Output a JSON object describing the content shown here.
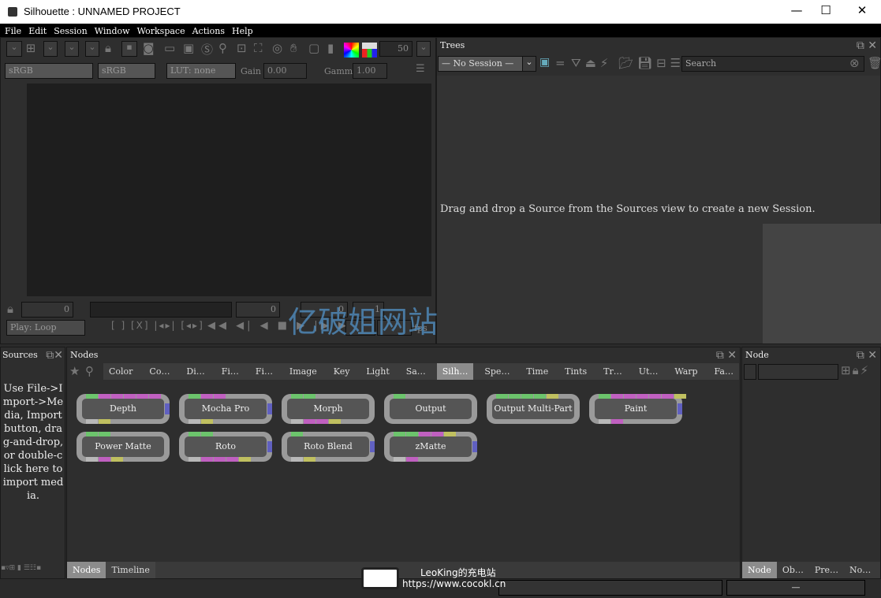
{
  "window": {
    "title": "Silhouette : UNNAMED PROJECT",
    "minimize": "—",
    "maximize": "☐",
    "close": "✕"
  },
  "menu": [
    "File",
    "Edit",
    "Session",
    "Window",
    "Workspace",
    "Actions",
    "Help"
  ],
  "viewer": {
    "zoom_value": "50",
    "colorspace_in": "sRGB",
    "colorspace_out": "sRGB",
    "lut": "LUT: none",
    "gain_label": "Gain",
    "gain": "0.00",
    "gamma_label": "Gamma",
    "gamma": "1.00",
    "frame_start": "0",
    "frame_current": "0",
    "frame_end": "0",
    "step": "1",
    "play_mode": "Play: Loop",
    "fps_label": "fps"
  },
  "trees": {
    "title": "Trees",
    "session": "— No Session —",
    "search_placeholder": "Search",
    "message": "Drag and drop a Source from the Sources view to create a new Session."
  },
  "sources": {
    "title": "Sources",
    "message": "Use File->Import->Media, Import button, drag-and-drop, or double-click here to import media."
  },
  "nodes_panel": {
    "title": "Nodes",
    "categories": [
      "Color",
      "Co…",
      "Di…",
      "Fi…",
      "Fi…",
      "Image",
      "Key",
      "Light",
      "Sa…",
      "Silh…",
      "Spe…",
      "Time",
      "Tints",
      "Tr…",
      "Ut…",
      "Warp",
      "Fa…"
    ],
    "active_category": "Silh…",
    "port_colors": {
      "g": "#6cc46c",
      "m": "#c060c0",
      "y": "#c0c060",
      "w": "#b8b8b8"
    },
    "nodes": [
      {
        "label": "Depth",
        "top": [
          "g",
          "m",
          "m",
          "m",
          "m",
          "m"
        ],
        "bottom": [
          "w",
          "y"
        ],
        "output": true
      },
      {
        "label": "Mocha Pro",
        "top": [
          "g",
          "m",
          "m"
        ],
        "bottom": [
          "w",
          "y"
        ],
        "output": true
      },
      {
        "label": "Morph",
        "top": [
          "g",
          "g"
        ],
        "bottom": [
          "w",
          "m",
          "m",
          "y"
        ],
        "output": false
      },
      {
        "label": "Output",
        "top": [
          "g"
        ],
        "bottom": [],
        "output": false
      },
      {
        "label": "Output Multi-Part",
        "top": [
          "g",
          "g",
          "g",
          "g",
          "y"
        ],
        "bottom": [],
        "output": false
      },
      {
        "label": "Paint",
        "top": [
          "g",
          "m",
          "m",
          "m",
          "m",
          "m",
          "y"
        ],
        "bottom": [
          "w",
          "m"
        ],
        "output": true
      },
      {
        "label": "Power Matte",
        "top": [
          "g",
          "g"
        ],
        "bottom": [
          "w",
          "m",
          "y"
        ],
        "output": false
      },
      {
        "label": "Roto",
        "top": [
          "g",
          "g"
        ],
        "bottom": [
          "w",
          "m",
          "m",
          "m",
          "y"
        ],
        "output": true
      },
      {
        "label": "Roto Blend",
        "top": [
          "g"
        ],
        "bottom": [
          "w",
          "y"
        ],
        "output": true
      },
      {
        "label": "zMatte",
        "top": [
          "g",
          "g",
          "m",
          "m",
          "y"
        ],
        "bottom": [
          "w",
          "m"
        ],
        "output": true
      }
    ],
    "bottom_tabs": [
      "Nodes",
      "Timeline"
    ]
  },
  "node_panel": {
    "title": "Node",
    "bottom_tabs": [
      "Node",
      "Ob…",
      "Pre…",
      "No…"
    ]
  },
  "status": {
    "right_value": "—"
  },
  "overlay": {
    "watermark": "亿破姐网站",
    "badge_line1": "LeoKing的充电站",
    "badge_line2": "https://www.cocokl.cn"
  }
}
